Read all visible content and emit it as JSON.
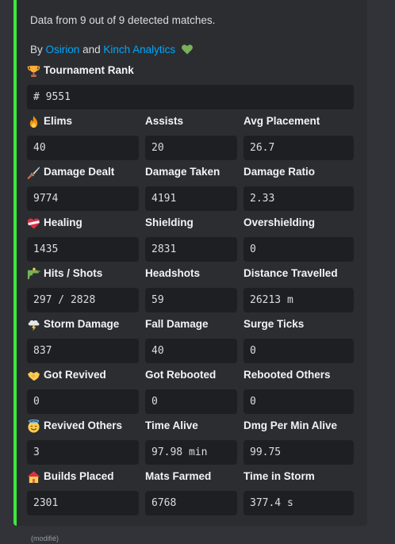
{
  "description": {
    "line1": "Data from 9 out of 9 detected matches.",
    "by": "By",
    "link1": "Osirion",
    "and": "and",
    "link2": "Kinch Analytics"
  },
  "accent_color": "#3ce83f",
  "link_color": "#00a8fc",
  "rank": {
    "name": "Tournament Rank",
    "value": "# 9551",
    "icon": "trophy-icon"
  },
  "rows": [
    [
      {
        "name": "Elims",
        "value": "40",
        "icon": "fire-icon"
      },
      {
        "name": "Assists",
        "value": "20"
      },
      {
        "name": "Avg Placement",
        "value": "26.7"
      }
    ],
    [
      {
        "name": "Damage Dealt",
        "value": "9774",
        "icon": "dagger-icon"
      },
      {
        "name": "Damage Taken",
        "value": "4191"
      },
      {
        "name": "Damage Ratio",
        "value": "2.33"
      }
    ],
    [
      {
        "name": "Healing",
        "value": "1435",
        "icon": "bandaged-heart-icon"
      },
      {
        "name": "Shielding",
        "value": "2831"
      },
      {
        "name": "Overshielding",
        "value": "0"
      }
    ],
    [
      {
        "name": "Hits / Shots",
        "value": "297 / 2828",
        "icon": "water-pistol-icon"
      },
      {
        "name": "Headshots",
        "value": "59"
      },
      {
        "name": "Distance Travelled",
        "value": "26213 m"
      }
    ],
    [
      {
        "name": "Storm Damage",
        "value": "837",
        "icon": "storm-cloud-icon"
      },
      {
        "name": "Fall Damage",
        "value": "40"
      },
      {
        "name": "Surge Ticks",
        "value": "0"
      }
    ],
    [
      {
        "name": "Got Revived",
        "value": "0",
        "icon": "handshake-icon"
      },
      {
        "name": "Got Rebooted",
        "value": "0"
      },
      {
        "name": "Rebooted Others",
        "value": "0"
      }
    ],
    [
      {
        "name": "Revived Others",
        "value": "3",
        "icon": "halo-face-icon"
      },
      {
        "name": "Time Alive",
        "value": "97.98 min"
      },
      {
        "name": "Dmg Per Min Alive",
        "value": "99.75"
      }
    ],
    [
      {
        "name": "Builds Placed",
        "value": "2301",
        "icon": "house-icon"
      },
      {
        "name": "Mats Farmed",
        "value": "6768"
      },
      {
        "name": "Time in Storm",
        "value": "377.4 s"
      }
    ]
  ],
  "footer": "(modifié)"
}
